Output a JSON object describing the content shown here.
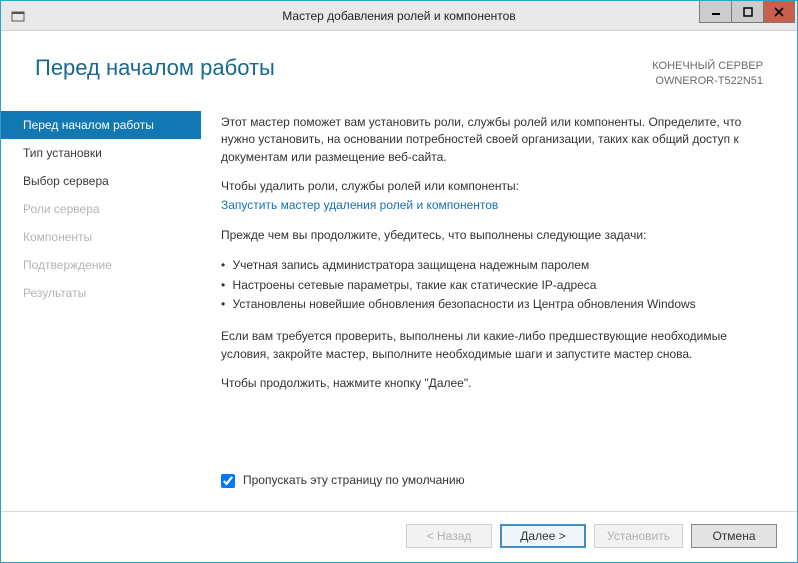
{
  "window": {
    "title": "Мастер добавления ролей и компонентов"
  },
  "header": {
    "title": "Перед началом работы",
    "server_label": "КОНЕЧНЫЙ СЕРВЕР",
    "server_name": "OWNEROR-T522N51"
  },
  "sidebar": {
    "items": [
      {
        "label": "Перед началом работы",
        "state": "active"
      },
      {
        "label": "Тип установки",
        "state": "normal"
      },
      {
        "label": "Выбор сервера",
        "state": "normal"
      },
      {
        "label": "Роли сервера",
        "state": "disabled"
      },
      {
        "label": "Компоненты",
        "state": "disabled"
      },
      {
        "label": "Подтверждение",
        "state": "disabled"
      },
      {
        "label": "Результаты",
        "state": "disabled"
      }
    ]
  },
  "content": {
    "intro": "Этот мастер поможет вам установить роли, службы ролей или компоненты. Определите, что нужно установить, на основании потребностей своей организации, таких как общий доступ к документам или размещение веб-сайта.",
    "remove_prefix": "Чтобы удалить роли, службы ролей или компоненты:",
    "remove_link": "Запустить мастер удаления ролей и компонентов",
    "prereq_intro": "Прежде чем вы продолжите, убедитесь, что выполнены следующие задачи:",
    "prereqs": [
      "Учетная запись администратора защищена надежным паролем",
      "Настроены сетевые параметры, такие как статические IP-адреса",
      "Установлены новейшие обновления безопасности из Центра обновления Windows"
    ],
    "verify": "Если вам требуется проверить, выполнены ли какие-либо предшествующие необходимые условия, закройте мастер, выполните необходимые шаги и запустите мастер снова.",
    "continue": "Чтобы продолжить, нажмите кнопку \"Далее\".",
    "skip_label": "Пропускать эту страницу по умолчанию",
    "skip_checked": true
  },
  "footer": {
    "back": "< Назад",
    "next": "Далее >",
    "install": "Установить",
    "cancel": "Отмена"
  }
}
